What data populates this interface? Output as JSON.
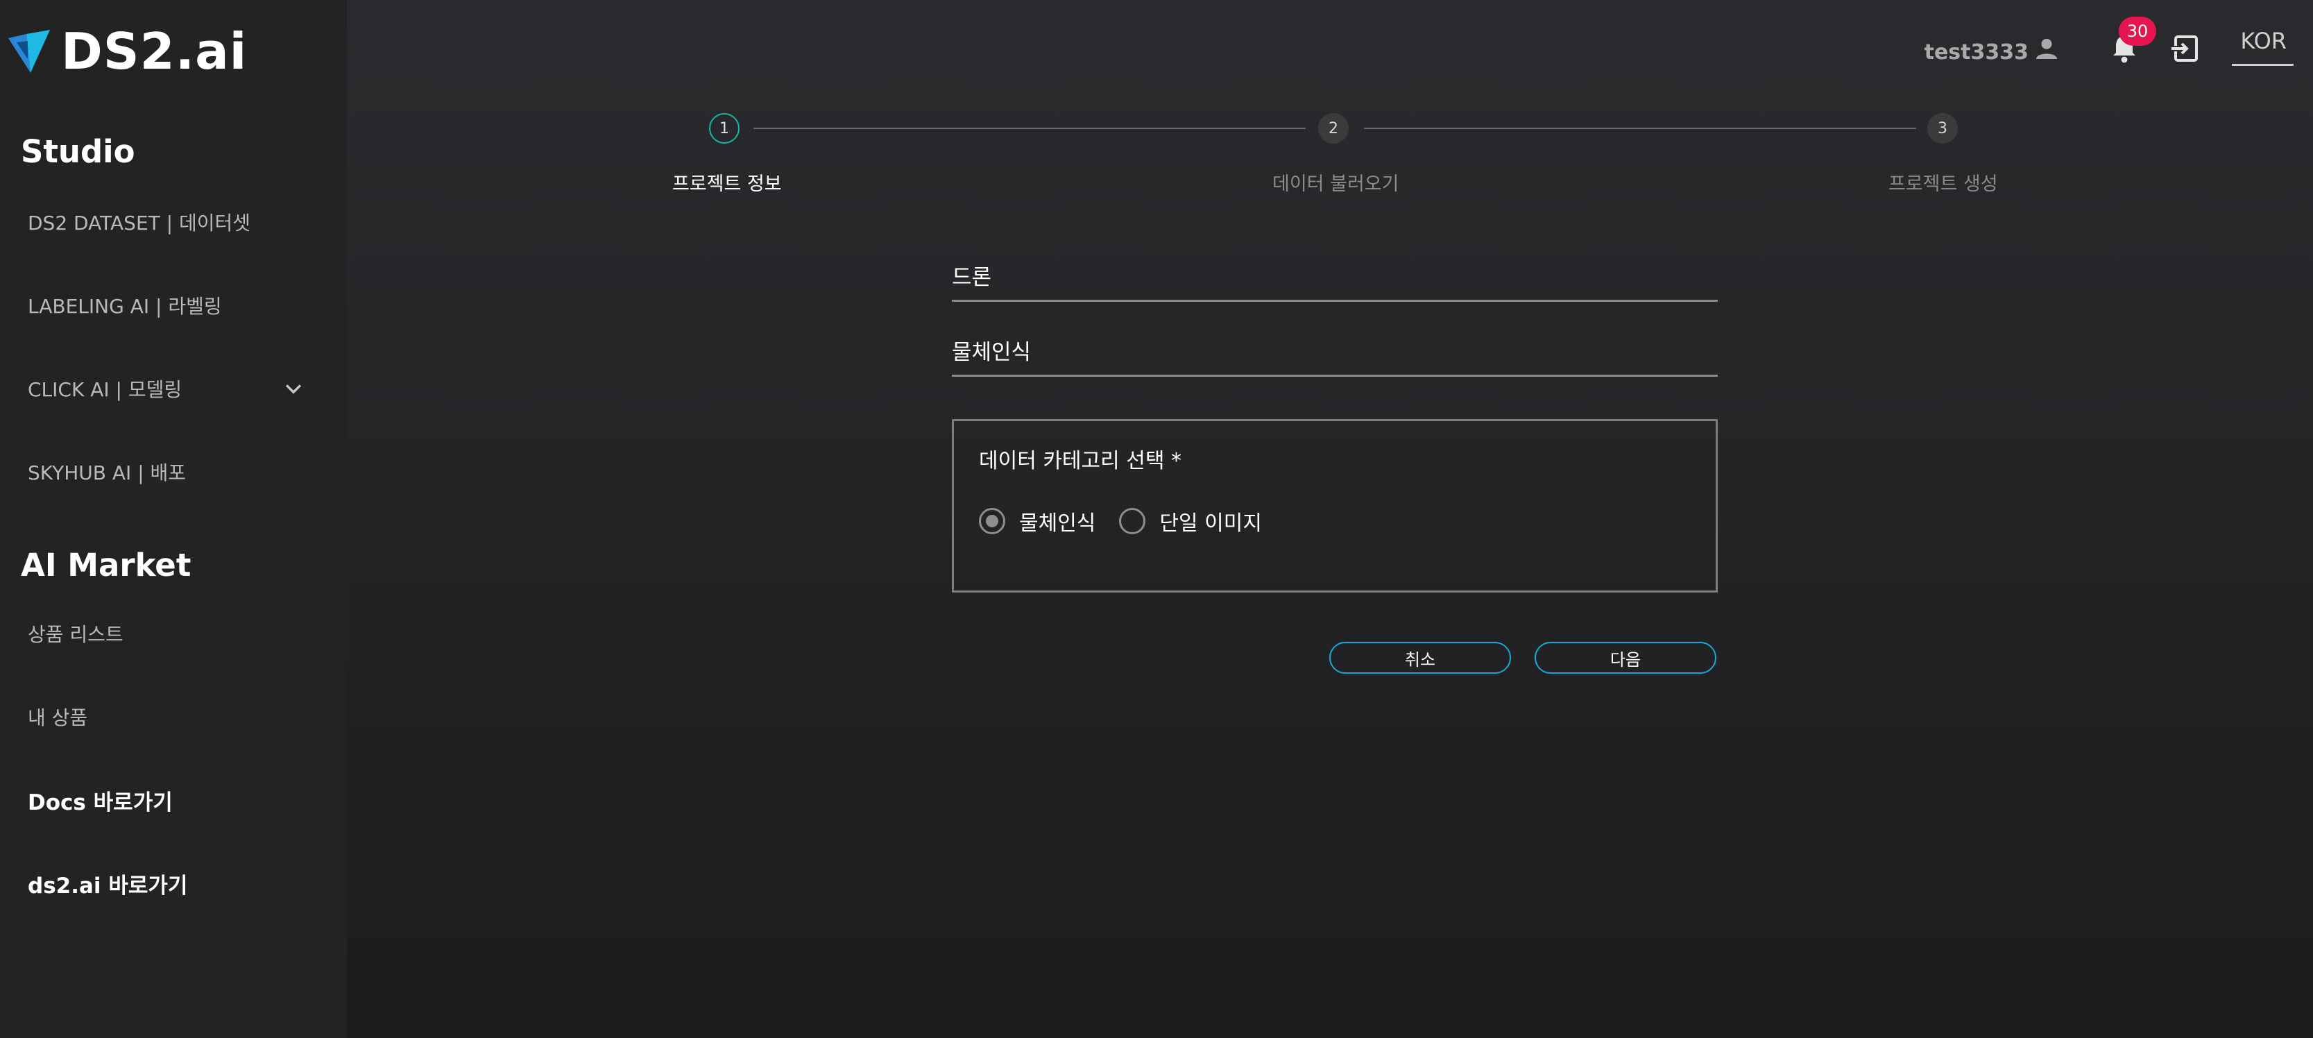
{
  "app": {
    "logo_text": "DS2.ai"
  },
  "sidebar": {
    "studio_title": "Studio",
    "studio_items": [
      {
        "label": "DS2 DATASET | 데이터셋"
      },
      {
        "label": "LABELING AI | 라벨링"
      },
      {
        "label": "CLICK AI | 모델링",
        "icon": "chevron-down-icon"
      },
      {
        "label": "SKYHUB AI | 배포"
      }
    ],
    "market_title": "AI Market",
    "market_items": [
      {
        "label": "상품 리스트"
      },
      {
        "label": "내 상품"
      }
    ],
    "links": [
      {
        "label": "Docs 바로가기"
      },
      {
        "label": "ds2.ai 바로가기"
      }
    ]
  },
  "topbar": {
    "username": "test3333",
    "notification_count": "30",
    "language": "KOR"
  },
  "stepper": {
    "steps": [
      {
        "number": "1",
        "label": "프로젝트 정보",
        "active": true
      },
      {
        "number": "2",
        "label": "데이터 불러오기",
        "active": false
      },
      {
        "number": "3",
        "label": "프로젝트 생성",
        "active": false
      }
    ]
  },
  "form": {
    "project_name_value": "드론",
    "project_desc_value": "물체인식",
    "category": {
      "title": "데이터 카테고리 선택 *",
      "options": [
        {
          "label": "물체인식",
          "selected": true
        },
        {
          "label": "단일 이미지",
          "selected": false
        }
      ]
    },
    "cancel_label": "취소",
    "next_label": "다음"
  },
  "colors": {
    "accent_teal": "#17b7a3",
    "button_border": "#1aa6d2",
    "badge": "#e6154f"
  }
}
